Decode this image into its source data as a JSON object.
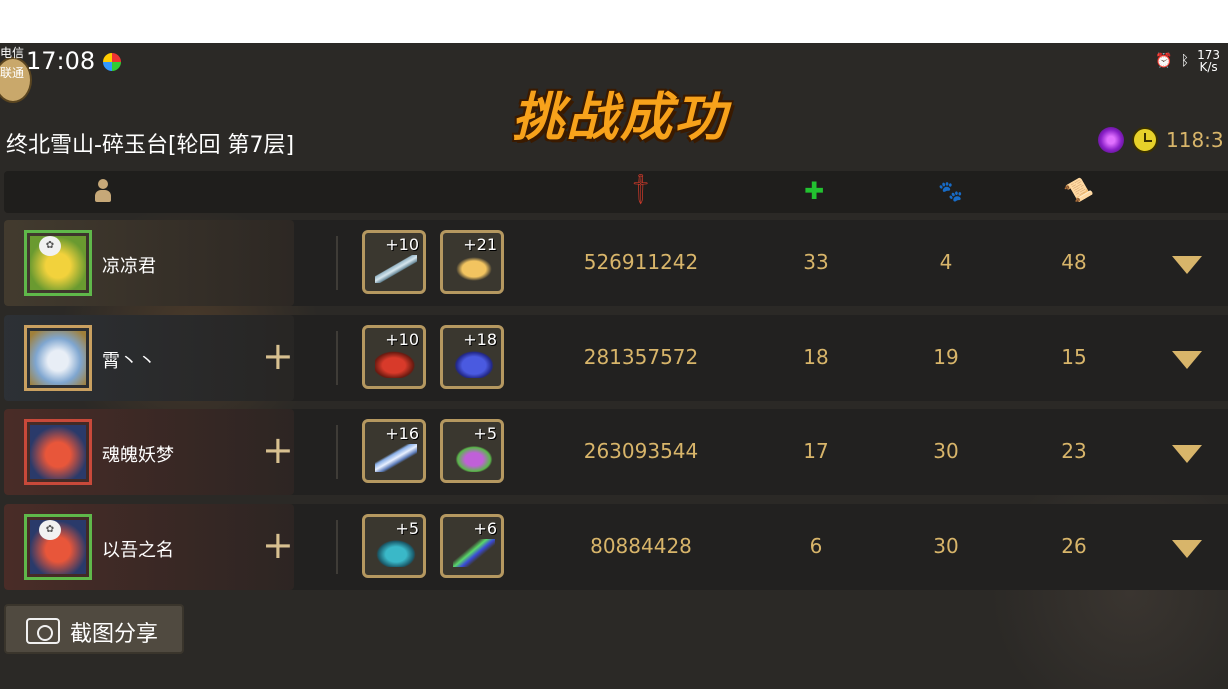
{
  "status_bar": {
    "carrier_line1": "电信",
    "carrier_line2": "联通",
    "time": "17:08",
    "net_speed_value": "173",
    "net_speed_unit": "K/s",
    "icons": [
      "alarm-icon",
      "bluetooth-icon"
    ]
  },
  "banner": {
    "text": "挑战成功"
  },
  "stage": {
    "title": "终北雪山-碎玉台[轮回  第7层]"
  },
  "resources": {
    "timer_text": "118:3"
  },
  "columns": {
    "icons": [
      "person-icon",
      "sword-icon",
      "heal-icon",
      "beast-icon",
      "scroll-icon"
    ]
  },
  "players": [
    {
      "name": "凉凉君",
      "frame_color": "#5fb84a",
      "item_a_level": "+10",
      "item_b_level": "+21",
      "damage": "526911242",
      "heal": "33",
      "beast": "4",
      "scroll": "48"
    },
    {
      "name": "霄丶丶",
      "frame_color": "#c9a060",
      "item_a_level": "+10",
      "item_b_level": "+18",
      "damage": "281357572",
      "heal": "18",
      "beast": "19",
      "scroll": "15"
    },
    {
      "name": "魂魄妖梦",
      "frame_color": "#c8493a",
      "item_a_level": "+16",
      "item_b_level": "+5",
      "damage": "263093544",
      "heal": "17",
      "beast": "30",
      "scroll": "23"
    },
    {
      "name": "以吾之名",
      "frame_color": "#5fb84a",
      "item_a_level": "+5",
      "item_b_level": "+6",
      "damage": "80884428",
      "heal": "6",
      "beast": "30",
      "scroll": "26"
    }
  ],
  "share_button": {
    "label": "截图分享"
  }
}
